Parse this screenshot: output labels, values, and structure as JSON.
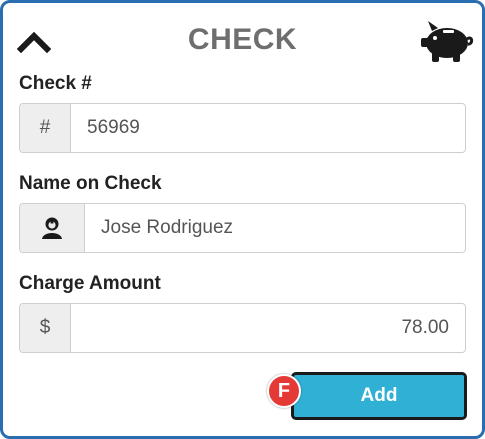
{
  "header": {
    "title": "CHECK",
    "collapse_icon": "chevron-up-icon",
    "brand_icon": "piggy-bank-icon"
  },
  "fields": {
    "check_number": {
      "label": "Check #",
      "addon": "#",
      "value": "56969"
    },
    "name_on_check": {
      "label": "Name on Check",
      "addon_icon": "user-icon",
      "value": "Jose Rodriguez"
    },
    "charge_amount": {
      "label": "Charge Amount",
      "addon": "$",
      "value": "78.00"
    }
  },
  "actions": {
    "add_label": "Add",
    "hotkey": "F"
  },
  "colors": {
    "panel_border": "#2a6db0",
    "title": "#6e6e6e",
    "add_button": "#31b0d5",
    "hotkey_badge": "#e53935"
  }
}
